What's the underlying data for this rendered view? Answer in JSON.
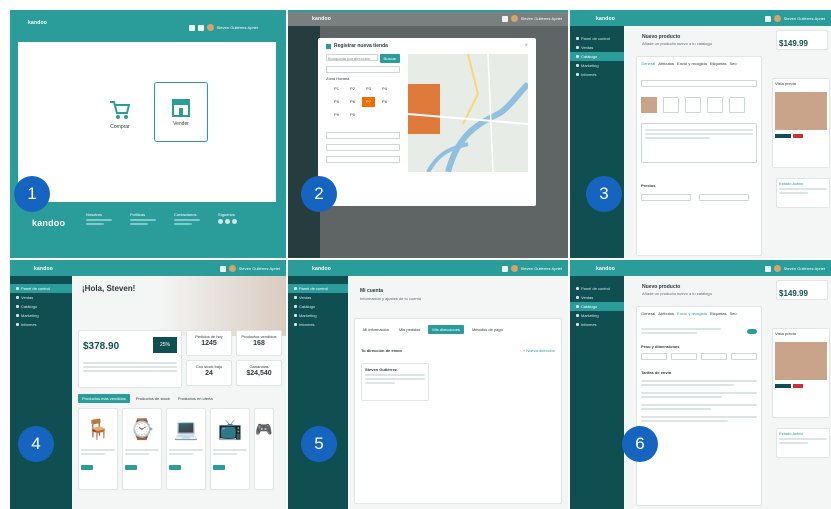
{
  "badges": [
    "1",
    "2",
    "3",
    "4",
    "5",
    "6"
  ],
  "brand": {
    "logo_text": "kandoo"
  },
  "user": {
    "name": "Steven Gutiérrez Apriet"
  },
  "sidebar": {
    "items": [
      "Panel de control",
      "Ventas",
      "Catálogo",
      "Marketing",
      "Informes"
    ]
  },
  "panel1": {
    "options": [
      {
        "label": "Comprar",
        "icon": "cart-icon"
      },
      {
        "label": "Vender",
        "icon": "store-icon"
      }
    ],
    "footer_cols": [
      "Nosotros",
      "Políticas",
      "Contactanos",
      "Síguenos"
    ]
  },
  "panel2": {
    "modal_title": "Registrar nueva tienda",
    "search_placeholder": "Busqueda por dirección",
    "search_button": "Buscar",
    "section_label": "Zona Horaria",
    "grid_labels": [
      "P1",
      "P2",
      "P3",
      "P4",
      "P5",
      "P6",
      "P7",
      "P8",
      "P9",
      "P0"
    ],
    "selected_cell": "P7"
  },
  "panel3": {
    "title": "Nuevo producto",
    "subtitle": "Añade un producto nuevo a tu catálogo",
    "price": "$149.99",
    "tabs": [
      "General",
      "Atributos",
      "Envío y recogida",
      "Etiquetas",
      "Seo"
    ],
    "section_prices": "Precios",
    "preview_label": "Vista previa",
    "status_label": "Estado Activo"
  },
  "panel4": {
    "greeting": "¡Hola, Steven!",
    "amount": "$378.90",
    "change": "25%",
    "stats": [
      {
        "label": "Pedidos de hoy",
        "value": "1245"
      },
      {
        "label": "Productos vendidos",
        "value": "168"
      },
      {
        "label": "Con stock bajo",
        "value": "24"
      },
      {
        "label": "Ganancias",
        "value": "$24,540"
      }
    ],
    "product_tabs": [
      "Productos más vendidos",
      "Productos de stock",
      "Productos en oferta"
    ],
    "product_icons": [
      "chair-icon",
      "watch-icon",
      "laptop-icon",
      "tv-icon",
      "controller-icon"
    ]
  },
  "panel5": {
    "title": "Mi cuenta",
    "subtitle": "Información y ajustes de tu cuenta",
    "tabs": [
      "Mi información",
      "Mis pedidos",
      "Mis direcciones",
      "Métodos de pago"
    ],
    "active_tab": "Mis direcciones",
    "address_title": "Tu dirección de envío",
    "add_link": "+ Nueva dirección",
    "address_name": "Steven Gutiérrez"
  },
  "panel6": {
    "title": "Nuevo producto",
    "subtitle": "Añade un producto nuevo a tu catálogo",
    "price": "$149.99",
    "tabs": [
      "General",
      "Atributos",
      "Envío y recogida",
      "Etiquetas",
      "Seo"
    ],
    "active_tab": "Envío y recogida",
    "section_dims": "Peso y dimensiones",
    "section_shipping": "Tarifas de envío",
    "preview_label": "Vista previa",
    "status_label": "Estado Activo"
  },
  "colors": {
    "primary": "#2a9d9b",
    "sidebar": "#0f4f52",
    "badge": "#1565c0",
    "accent": "#ef6c00"
  }
}
